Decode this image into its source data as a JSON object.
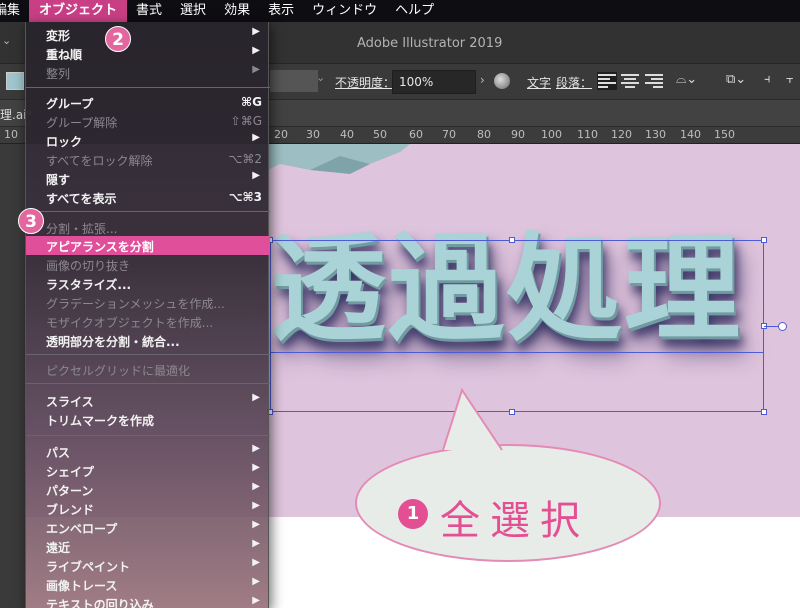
{
  "menubar": {
    "items": [
      "編集",
      "オブジェクト",
      "書式",
      "選択",
      "効果",
      "表示",
      "ウィンドウ",
      "ヘルプ"
    ],
    "active_index": 1
  },
  "window": {
    "title": "Adobe Illustrator 2019"
  },
  "controlbar": {
    "opacity_label": "不透明度：",
    "opacity_value": "100%",
    "char_label": "文字",
    "para_label": "段落："
  },
  "doc_tab": {
    "name": "理.ai*"
  },
  "ruler": {
    "labels": [
      "10",
      "20",
      "10",
      "20",
      "30",
      "40",
      "50",
      "60",
      "70",
      "80",
      "90",
      "100",
      "110",
      "120",
      "130",
      "140",
      "150"
    ]
  },
  "menu": {
    "items": [
      {
        "label": "変形",
        "submenu": true,
        "enabled": true
      },
      {
        "label": "重ね順",
        "submenu": true,
        "enabled": true
      },
      {
        "label": "整列",
        "submenu": true,
        "enabled": false
      },
      {
        "sep": true
      },
      {
        "label": "グループ",
        "shortcut": "⌘G",
        "enabled": true
      },
      {
        "label": "グループ解除",
        "shortcut": "⇧⌘G",
        "enabled": false
      },
      {
        "label": "ロック",
        "submenu": true,
        "enabled": true
      },
      {
        "label": "すべてをロック解除",
        "shortcut": "⌥⌘2",
        "enabled": false
      },
      {
        "label": "隠す",
        "submenu": true,
        "enabled": true
      },
      {
        "label": "すべてを表示",
        "shortcut": "⌥⌘3",
        "enabled": true
      },
      {
        "sep": true
      },
      {
        "label": "分割・拡張...",
        "enabled": false
      },
      {
        "label": "アピアランスを分割",
        "enabled": true,
        "highlighted": true
      },
      {
        "label": "画像の切り抜き",
        "enabled": false
      },
      {
        "label": "ラスタライズ...",
        "enabled": true
      },
      {
        "label": "グラデーションメッシュを作成...",
        "enabled": false
      },
      {
        "label": "モザイクオブジェクトを作成...",
        "enabled": false
      },
      {
        "label": "透明部分を分割・統合...",
        "enabled": true
      },
      {
        "sep": true
      },
      {
        "label": "ピクセルグリッドに最適化",
        "enabled": false
      },
      {
        "sep": true
      },
      {
        "label": "スライス",
        "submenu": true,
        "enabled": true
      },
      {
        "label": "トリムマークを作成",
        "enabled": true
      },
      {
        "sep": true
      },
      {
        "label": "パス",
        "submenu": true,
        "enabled": true
      },
      {
        "label": "シェイプ",
        "submenu": true,
        "enabled": true
      },
      {
        "label": "パターン",
        "submenu": true,
        "enabled": true
      },
      {
        "label": "ブレンド",
        "submenu": true,
        "enabled": true
      },
      {
        "label": "エンベロープ",
        "submenu": true,
        "enabled": true
      },
      {
        "label": "遠近",
        "submenu": true,
        "enabled": true
      },
      {
        "label": "ライブペイント",
        "submenu": true,
        "enabled": true
      },
      {
        "label": "画像トレース",
        "submenu": true,
        "enabled": true
      },
      {
        "label": "テキストの回り込み",
        "submenu": true,
        "enabled": true
      }
    ]
  },
  "canvas": {
    "art_text": "透過処理",
    "bubble_badge": "1",
    "bubble_text": "全選択"
  },
  "badges": {
    "step2": "2",
    "step3": "3"
  },
  "colors": {
    "menu_highlight": "#e0509a",
    "badge": "#e3679f",
    "art_text": "#a9d3d6",
    "pink_band": "#dfc4dd"
  }
}
